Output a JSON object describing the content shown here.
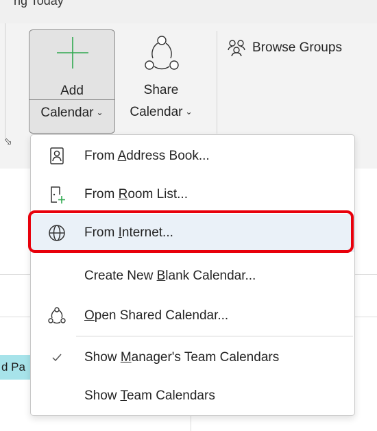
{
  "top_strip": {
    "partial_text": "ng Today"
  },
  "ribbon": {
    "add_calendar": {
      "line1": "Add",
      "line2": "Calendar",
      "chevron": "⌄"
    },
    "share_calendar": {
      "line1": "Share",
      "line2": "Calendar",
      "chevron": "⌄"
    },
    "browse_groups": {
      "label": "Browse Groups",
      "icon": "people-icon"
    },
    "launcher_glyph": "⬂"
  },
  "event_chip": {
    "text": "d Pa"
  },
  "menu": {
    "items": [
      {
        "pre": "From ",
        "key": "A",
        "post": "ddress Book...",
        "icon": "address-book-icon"
      },
      {
        "pre": "From ",
        "key": "R",
        "post": "oom List...",
        "icon": "room-list-icon"
      },
      {
        "pre": "From ",
        "key": "I",
        "post": "nternet...",
        "icon": "globe-icon",
        "selected": true
      },
      {
        "pre": "Create New ",
        "key": "B",
        "post": "lank Calendar...",
        "icon": ""
      },
      {
        "pre": "",
        "key": "O",
        "post": "pen Shared Calendar...",
        "icon": "shared-calendar-icon"
      },
      {
        "pre": "Show ",
        "key": "M",
        "post": "anager's Team Calendars",
        "icon": "checkmark-icon"
      },
      {
        "pre": "Show ",
        "key": "T",
        "post": "eam Calendars",
        "icon": ""
      }
    ]
  },
  "colors": {
    "accent_green": "#2fa84f",
    "highlight_red": "#e8000b",
    "selected_bg": "#eaf1f8",
    "event_chip": "#a7e3ea"
  }
}
